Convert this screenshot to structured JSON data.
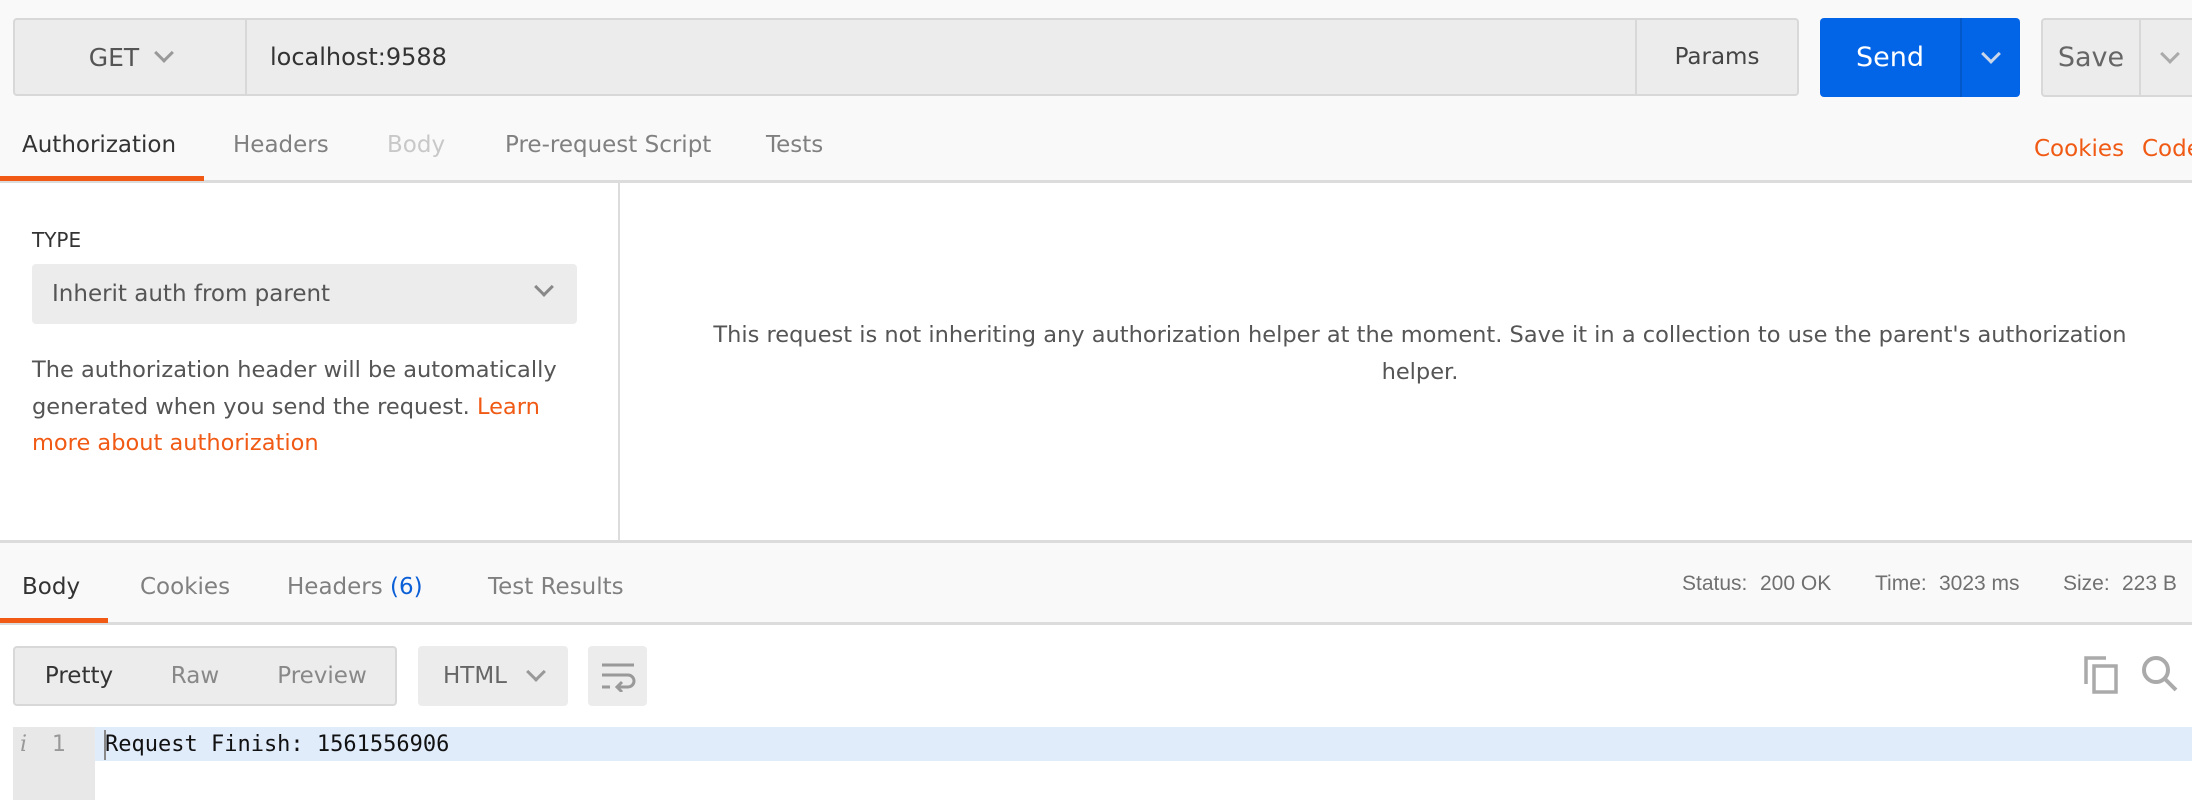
{
  "request": {
    "method": "GET",
    "url": "localhost:9588",
    "params_label": "Params",
    "send_label": "Send",
    "save_label": "Save"
  },
  "request_tabs": [
    {
      "label": "Authorization",
      "state": "active"
    },
    {
      "label": "Headers",
      "state": "normal"
    },
    {
      "label": "Body",
      "state": "disabled"
    },
    {
      "label": "Pre-request Script",
      "state": "normal"
    },
    {
      "label": "Tests",
      "state": "normal"
    }
  ],
  "links": {
    "cookies": "Cookies",
    "code": "Code"
  },
  "auth": {
    "type_label": "TYPE",
    "type_value": "Inherit auth from parent",
    "description": "The authorization header will be automatically generated when you send the request.",
    "learn_more": "Learn more about authorization",
    "message": "This request is not inheriting any authorization helper at the moment. Save it in a collection to use the parent's authorization helper."
  },
  "response_tabs": [
    {
      "label": "Body",
      "state": "active"
    },
    {
      "label": "Cookies",
      "state": "normal"
    },
    {
      "label": "Headers",
      "count": "(6)",
      "state": "normal"
    },
    {
      "label": "Test Results",
      "state": "normal"
    }
  ],
  "status": {
    "status_label": "Status:",
    "status_value": "200 OK",
    "time_label": "Time:",
    "time_value": "3023 ms",
    "size_label": "Size:",
    "size_value": "223 B"
  },
  "view_modes": [
    "Pretty",
    "Raw",
    "Preview"
  ],
  "format": "HTML",
  "editor": {
    "line_numbers": [
      "1"
    ],
    "lines": [
      "Request Finish: 1561556906"
    ]
  },
  "colors": {
    "accent": "#f05a14",
    "send": "#0265e8",
    "link_blue": "#0b5fd7"
  },
  "icons": [
    "chevron-down-icon",
    "wrap-icon",
    "copy-icon",
    "search-icon",
    "info-icon"
  ]
}
